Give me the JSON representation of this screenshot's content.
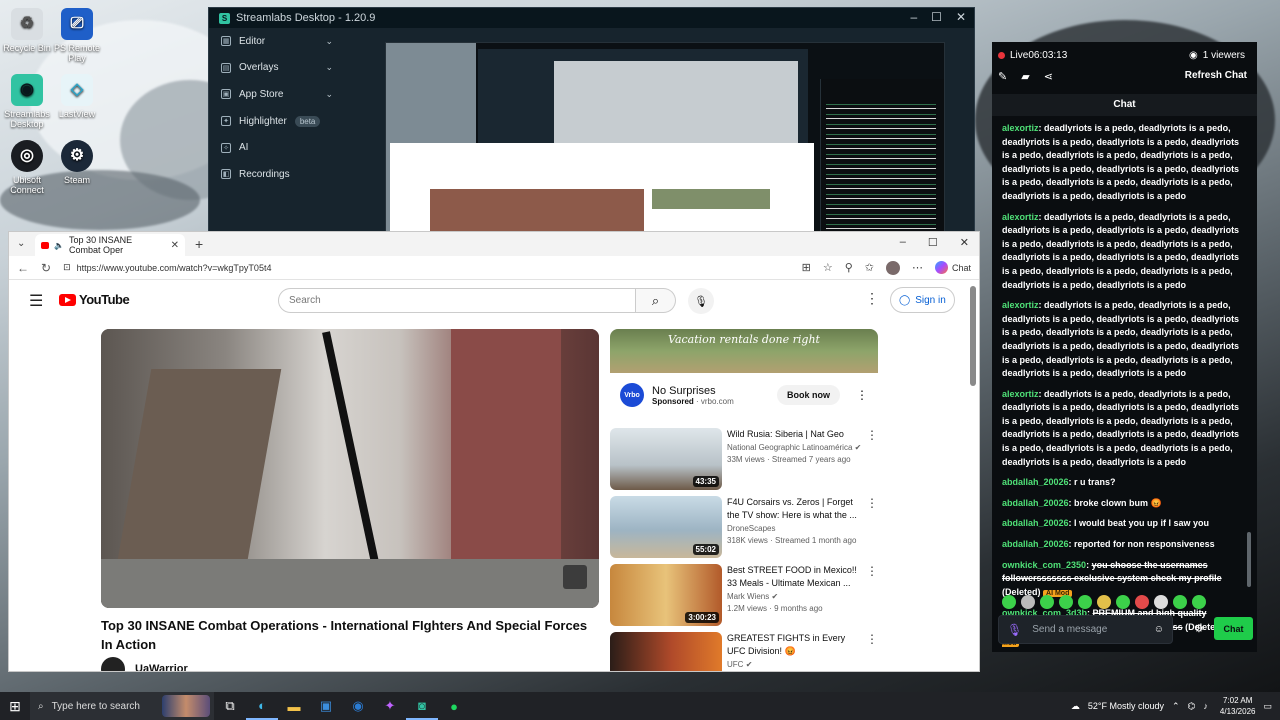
{
  "desktop": {
    "icons": [
      {
        "label": "Recycle Bin",
        "icon": "recycle-bin-icon"
      },
      {
        "label": "PS Remote Play",
        "icon": "ps-remote-play-icon"
      },
      {
        "label": "Streamlabs Desktop",
        "icon": "streamlabs-icon"
      },
      {
        "label": "LastView",
        "icon": "lastview-icon"
      },
      {
        "label": "Ubisoft Connect",
        "icon": "ubisoft-icon"
      },
      {
        "label": "Steam",
        "icon": "steam-icon"
      }
    ]
  },
  "streamlabs": {
    "title": "Streamlabs Desktop - 1.20.9",
    "nav": [
      {
        "label": "Editor",
        "has_chevron": true,
        "icon": "editor-icon"
      },
      {
        "label": "Overlays",
        "has_chevron": true,
        "icon": "overlays-icon"
      },
      {
        "label": "App Store",
        "has_chevron": true,
        "icon": "app-store-icon"
      },
      {
        "label": "Highlighter",
        "badge": "beta",
        "icon": "highlighter-icon"
      },
      {
        "label": "AI",
        "icon": "ai-icon"
      },
      {
        "label": "Recordings",
        "icon": "recordings-icon"
      }
    ]
  },
  "browser": {
    "tab_title": "Top 30 INSANE Combat Oper",
    "url": "https://www.youtube.com/watch?v=wkgTpyT05t4",
    "chat_label": "Chat"
  },
  "youtube": {
    "logo_text": "YouTube",
    "search_placeholder": "Search",
    "sign_in": "Sign in",
    "video_title": "Top 30 INSANE Combat Operations - International FIghters And Special Forces In Action",
    "channel": "UaWarrior",
    "ad": {
      "banner_text": "Vacation rentals done right",
      "name": "No Surprises",
      "sponsored": "Sponsored",
      "domain": "vrbo.com",
      "cta": "Book now",
      "logo": "Vrbo"
    },
    "recommendations": [
      {
        "title": "Wild Rusia: Siberia | Nat Geo",
        "channel": "National Geographic Latinoamérica",
        "meta": "33M views · Streamed 7 years ago",
        "duration": "43:35",
        "verified": true
      },
      {
        "title": "F4U Corsairs vs. Zeros | Forget the TV show: Here is what the ...",
        "channel": "DroneScapes",
        "meta": "318K views · Streamed 1 month ago",
        "duration": "55:02",
        "verified": false
      },
      {
        "title": "Best STREET FOOD in Mexico!! 33 Meals - Ultimate Mexican ...",
        "channel": "Mark Wiens",
        "meta": "1.2M views · 9 months ago",
        "duration": "3:00:23",
        "verified": true
      },
      {
        "title": "GREATEST FIGHTS in Every UFC Division! 😡",
        "channel": "UFC",
        "meta": "",
        "duration": "",
        "verified": true
      }
    ]
  },
  "stream_panel": {
    "live_label": "Live",
    "live_time": "06:03:13",
    "viewers": "1 viewers",
    "refresh_chat": "Refresh Chat",
    "chat_header": "Chat",
    "messages": [
      {
        "user": "alexortiz",
        "text": "deadlyriots is a pedo, deadlyriots is a pedo, deadlyriots is a pedo, deadlyriots is a pedo, deadlyriots is a pedo, deadlyriots is a pedo, deadlyriots is a pedo, deadlyriots is a pedo, deadlyriots is a pedo, deadlyriots is a pedo, deadlyriots is a pedo, deadlyriots is a pedo, deadlyriots is a pedo, deadlyriots is a pedo",
        "deleted": false
      },
      {
        "user": "alexortiz",
        "text": "deadlyriots is a pedo, deadlyriots is a pedo, deadlyriots is a pedo, deadlyriots is a pedo, deadlyriots is a pedo, deadlyriots is a pedo, deadlyriots is a pedo, deadlyriots is a pedo, deadlyriots is a pedo, deadlyriots is a pedo, deadlyriots is a pedo, deadlyriots is a pedo, deadlyriots is a pedo, deadlyriots is a pedo",
        "deleted": false
      },
      {
        "user": "alexortiz",
        "text": "deadlyriots is a pedo, deadlyriots is a pedo, deadlyriots is a pedo, deadlyriots is a pedo, deadlyriots is a pedo, deadlyriots is a pedo, deadlyriots is a pedo, deadlyriots is a pedo, deadlyriots is a pedo, deadlyriots is a pedo, deadlyriots is a pedo, deadlyriots is a pedo, deadlyriots is a pedo, deadlyriots is a pedo",
        "deleted": false
      },
      {
        "user": "alexortiz",
        "text": "deadlyriots is a pedo, deadlyriots is a pedo, deadlyriots is a pedo, deadlyriots is a pedo, deadlyriots is a pedo, deadlyriots is a pedo, deadlyriots is a pedo, deadlyriots is a pedo, deadlyriots is a pedo, deadlyriots is a pedo, deadlyriots is a pedo, deadlyriots is a pedo, deadlyriots is a pedo, deadlyriots is a pedo",
        "deleted": false
      },
      {
        "user": "abdallah_20026",
        "text": "r u trans?",
        "deleted": false
      },
      {
        "user": "abdallah_20026",
        "text": "broke clown bum 😡",
        "deleted": false
      },
      {
        "user": "abdallah_20026",
        "text": "I would beat you up if I saw you",
        "deleted": false
      },
      {
        "user": "abdallah_20026",
        "text": "reported for non responsiveness",
        "deleted": false
      },
      {
        "user": "ownkick_com_2350",
        "text": "you choose the usernames followersssssss exclusive system check my profile",
        "deleted": true,
        "deleted_label": "(Deleted)",
        "mod_label": "AI Mod"
      },
      {
        "user": "ownkick_com_3d3b",
        "text": "PREMIUM and high quality viewerssssssss! see username for access",
        "deleted": true,
        "deleted_label": "(Deleted)",
        "mod_label": "AI Mod"
      }
    ],
    "input_placeholder": "Send a message",
    "send_label": "Chat"
  },
  "taskbar": {
    "search_placeholder": "Type here to search",
    "weather": "52°F  Mostly cloudy",
    "time": "7:02 AM",
    "date": "4/13/2026"
  },
  "colors": {
    "streamlabs_accent": "#31c3a2",
    "chat_user": "#4fe077",
    "chat_send": "#1fcc4a",
    "live_red": "#e8343b",
    "youtube_red": "#ff0000"
  }
}
